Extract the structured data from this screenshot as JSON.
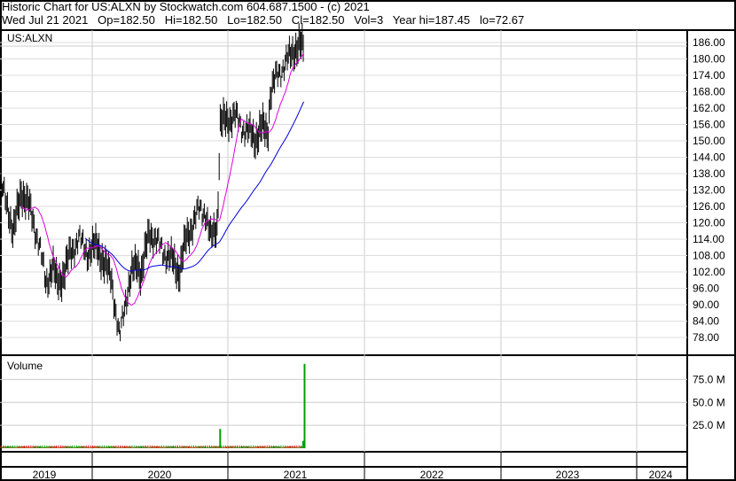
{
  "header": {
    "title": "Historic Chart for US:ALXN by Stockwatch.com 604.687.1500 - (c) 2021",
    "quote": "Wed Jul 21 2021   Op=182.50   Hi=182.50   Lo=182.50   Cl=182.50   Vol=3   Year hi=187.45   lo=72.67"
  },
  "chart_data": [
    {
      "type": "line",
      "title": "US:ALXN",
      "ylim": [
        72,
        190
      ],
      "yticks": [
        "186.00",
        "180.00",
        "174.00",
        "168.00",
        "162.00",
        "156.00",
        "150.00",
        "144.00",
        "138.00",
        "132.00",
        "126.00",
        "120.00",
        "114.00",
        "108.00",
        "102.00",
        "96.00",
        "90.00",
        "84.00",
        "78.00"
      ],
      "x_years": [
        2019.32,
        2019.39,
        2019.42,
        2019.48,
        2019.55,
        2019.61,
        2019.66,
        2019.71,
        2019.74,
        2019.79,
        2019.84,
        2019.9,
        2019.97,
        2020.04,
        2020.09,
        2020.14,
        2020.17,
        2020.2,
        2020.24,
        2020.29,
        2020.33,
        2020.36,
        2020.42,
        2020.46,
        2020.53,
        2020.59,
        2020.64,
        2020.69,
        2020.76,
        2020.79,
        2020.83,
        2020.87,
        2020.92,
        2020.94,
        2021.0,
        2021.05,
        2021.1,
        2021.15,
        2021.2,
        2021.25,
        2021.29,
        2021.31,
        2021.36,
        2021.4,
        2021.44,
        2021.49,
        2021.53,
        2021.56
      ],
      "close": [
        135,
        124,
        116,
        132,
        124,
        112,
        98,
        104,
        98,
        101,
        109,
        114,
        109,
        112,
        104,
        101,
        88,
        77,
        91,
        101,
        106,
        101,
        117,
        114,
        109,
        106,
        102,
        114,
        122,
        125,
        124,
        114,
        120,
        156,
        158,
        159,
        155,
        153,
        151,
        155,
        153,
        168,
        174,
        177,
        180,
        184,
        185,
        182.5
      ],
      "series": [
        {
          "name": "Price",
          "color": "#000000"
        },
        {
          "name": "Short MA",
          "color": "#e000e0"
        },
        {
          "name": "Long MA",
          "color": "#0000e0"
        }
      ]
    },
    {
      "type": "bar",
      "title": "Volume",
      "yticks": [
        "75.0 M",
        "50.0 M",
        "25.0 M"
      ],
      "ylim": [
        0,
        100
      ],
      "spikes": [
        {
          "x_year": 2020.94,
          "value_m": 21
        },
        {
          "x_year": 2021.55,
          "value_m": 8
        },
        {
          "x_year": 2021.56,
          "value_m": 92
        }
      ],
      "baseline_value_m": 2
    }
  ],
  "x_axis": {
    "years": [
      "2019",
      "2020",
      "2021",
      "2022",
      "2023",
      "2024"
    ]
  }
}
